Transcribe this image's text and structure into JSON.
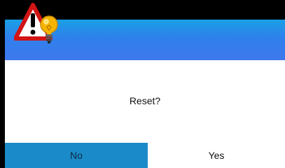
{
  "dialog": {
    "header_icon": "warning-bulb-icon",
    "message": "Reset?",
    "buttons": {
      "no_label": "No",
      "yes_label": "Yes"
    }
  },
  "colors": {
    "header_top": "#1aa0e6",
    "header_bottom": "#3f78ee",
    "no_button_bg": "#1a8bc8",
    "yes_button_bg": "#ffffff",
    "warning_red": "#d11414",
    "bulb_yellow": "#f4b400"
  }
}
